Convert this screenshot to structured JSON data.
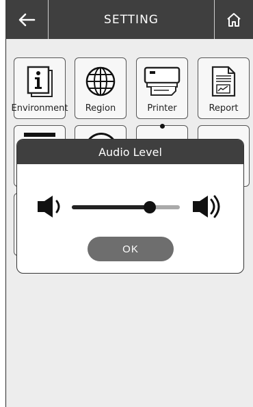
{
  "header": {
    "title": "SETTING",
    "back_icon": "arrow-left-icon",
    "home_icon": "home-icon"
  },
  "tiles": [
    {
      "label": "Environment",
      "icon": "info-icon"
    },
    {
      "label": "Region",
      "icon": "globe-icon"
    },
    {
      "label": "Printer",
      "icon": "printer-icon"
    },
    {
      "label": "Report",
      "icon": "report-icon"
    }
  ],
  "dialog": {
    "title": "Audio Level",
    "ok_label": "OK",
    "level": 0.72,
    "low_icon": "speaker-low-icon",
    "high_icon": "speaker-high-icon"
  },
  "colors": {
    "header_bg": "#3f3f3f",
    "page_bg": "#ededed",
    "button_bg": "#6e6e6e"
  }
}
